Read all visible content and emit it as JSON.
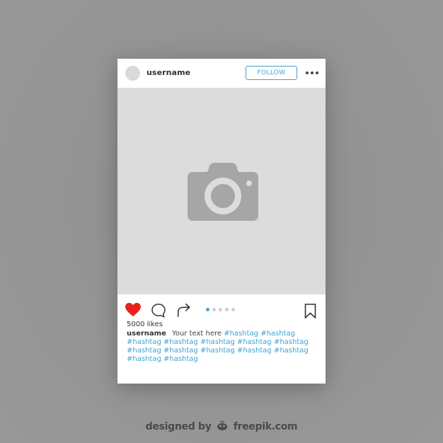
{
  "post": {
    "header": {
      "username": "username",
      "follow_label": "FOLLOW",
      "more_icon": "more-horizontal-icon"
    },
    "image": {
      "placeholder_icon": "camera-icon"
    },
    "actions": {
      "like_icon": "heart-filled-icon",
      "comment_icon": "comment-bubble-icon",
      "share_icon": "share-arrow-icon",
      "save_icon": "bookmark-icon",
      "carousel": {
        "total": 5,
        "active_index": 0
      }
    },
    "likes": "5000 likes",
    "caption": {
      "username": "username",
      "text": "Your text here",
      "hashtags": [
        "#hashtag",
        "#hashtag",
        "#hashtag",
        "#hashtag",
        "#hashtag",
        "#hashtag",
        "#hashtag",
        "#hashtag",
        "#hashtag",
        "#hashtag",
        "#hashtag",
        "#hashtag",
        "#hashtag",
        "#hashtag"
      ]
    }
  },
  "colors": {
    "accent": "#3fa3cf",
    "like": "#e8221b",
    "placeholder_bg": "#dcdcdc",
    "camera": "#a6a6a6",
    "background": "#959595"
  },
  "credit": {
    "prefix": "designed by",
    "brand": "freepik.com"
  }
}
